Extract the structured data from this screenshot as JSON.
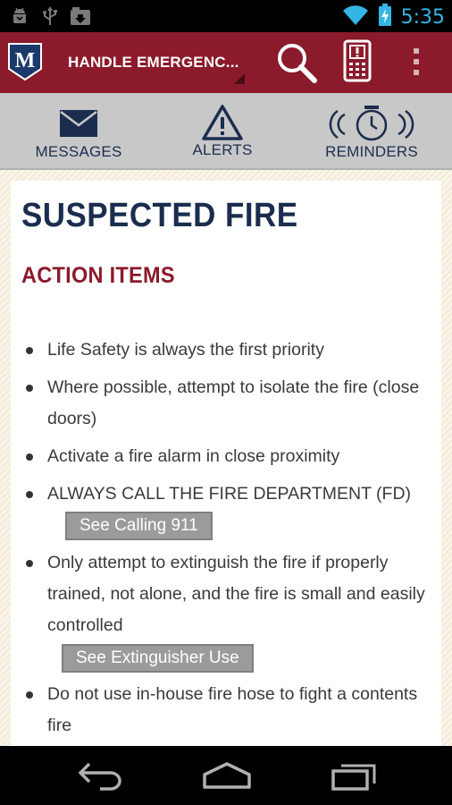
{
  "status_bar": {
    "time": "5:35",
    "icons": [
      "android-debug-icon",
      "usb-icon",
      "download-icon",
      "wifi-icon",
      "battery-charging-icon"
    ],
    "accent_color": "#33b5e5"
  },
  "action_bar": {
    "title": "HANDLE EMERGENC...",
    "logo_letter": "M",
    "background": "#8b1a2b",
    "icons": [
      "search-icon",
      "phone-icon",
      "overflow-menu-icon"
    ]
  },
  "tabs": [
    {
      "label": "MESSAGES",
      "icon": "envelope-icon"
    },
    {
      "label": "ALERTS",
      "icon": "warning-icon"
    },
    {
      "label": "REMINDERS",
      "icon": "alarm-clock-icon"
    }
  ],
  "content": {
    "title": "SUSPECTED FIRE",
    "section": "ACTION ITEMS",
    "items": [
      {
        "text": "Life Safety is always the first priority"
      },
      {
        "text": "Where possible, attempt to isolate the fire (close doors)"
      },
      {
        "text": "Activate a fire alarm in close proximity"
      },
      {
        "text": "ALWAYS CALL THE FIRE DEPARTMENT (FD)",
        "link": "See Calling 911"
      },
      {
        "text": "Only attempt to extinguish the fire if properly trained, not alone, and the fire is small and easily controlled",
        "link": "See Extinguisher Use"
      },
      {
        "text": "Do not use in-house fire hose to fight a contents fire"
      }
    ]
  },
  "nav_bar": {
    "buttons": [
      "back-icon",
      "home-icon",
      "recent-apps-icon"
    ]
  }
}
